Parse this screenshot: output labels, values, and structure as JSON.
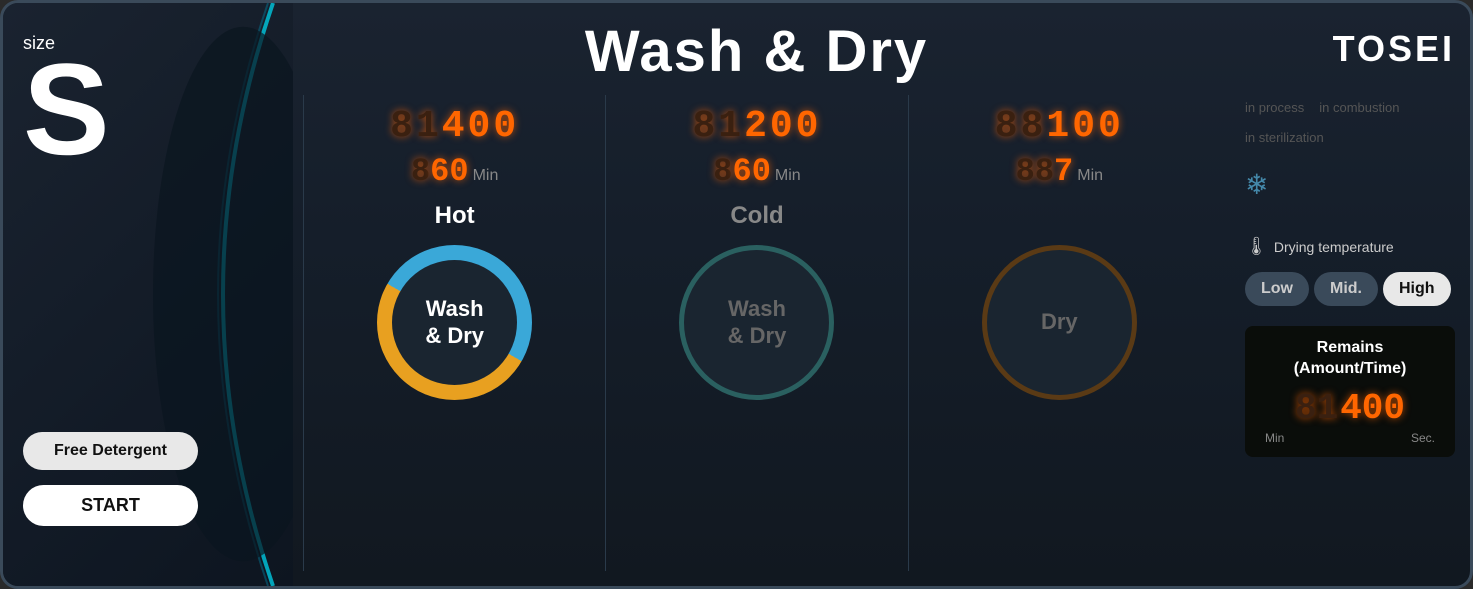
{
  "brand": "TOSEI",
  "title": "Wash & Dry",
  "size": {
    "label": "size",
    "value": "S"
  },
  "buttons": {
    "detergent": "Free Detergent",
    "start": "START"
  },
  "columns": [
    {
      "id": "hot",
      "price_dim": "81",
      "price_bright": "400",
      "timer_dim": "8",
      "timer_bright": "60",
      "unit": "Min",
      "temp": "Hot",
      "temp_active": true,
      "circle_text": "Wash\n& Dry",
      "circle_style": "active"
    },
    {
      "id": "cold",
      "price_dim": "81",
      "price_bright": "200",
      "timer_dim": "8",
      "timer_bright": "60",
      "unit": "Min",
      "temp": "Cold",
      "temp_active": false,
      "circle_text": "Wash\n& Dry",
      "circle_style": "teal"
    },
    {
      "id": "dry",
      "price_dim": "88",
      "price_bright": "100",
      "timer_dim": "88",
      "timer_bright": "7",
      "unit": "Min",
      "temp": "",
      "temp_active": false,
      "circle_text": "Dry",
      "circle_style": "brown"
    }
  ],
  "status": {
    "in_process": "in process",
    "in_combustion": "in combustion",
    "in_sterilization": "in sterilization"
  },
  "drying_temp": {
    "label": "Drying temperature",
    "options": [
      "Low",
      "Mid.",
      "High"
    ],
    "selected": "High"
  },
  "remains": {
    "title": "Remains\n(Amount/Time)",
    "dim": "81",
    "bright": "400",
    "min_label": "Min",
    "sec_label": "Sec."
  }
}
